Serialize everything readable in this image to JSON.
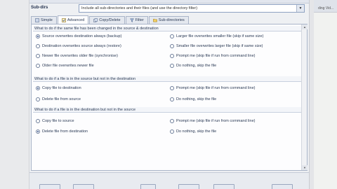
{
  "subdirs": {
    "label": "Sub-dirs",
    "value": "Include all sub-directories and their files (and use the directory filter)"
  },
  "right_hint": "ding Vid...",
  "tabs": [
    {
      "label": "Simple",
      "active": false
    },
    {
      "label": "Advanced",
      "active": true
    },
    {
      "label": "Copy/Delete",
      "active": false
    },
    {
      "label": "Filter",
      "active": false
    },
    {
      "label": "Sub-directories",
      "active": false
    }
  ],
  "groups": [
    {
      "header": "What to do if the same file has been changed in the source & destination",
      "options": [
        {
          "label": "Source overwrites destination always (backup)",
          "selected": true
        },
        {
          "label": "Larger file overwrites smaller file (skip if same size)",
          "selected": false
        },
        {
          "label": "Destination overwrites source always (restore)",
          "selected": false
        },
        {
          "label": "Smaller file overwrites larger file (skip if same size)",
          "selected": false
        },
        {
          "label": "Newer file overwrites older file (synchronise)",
          "selected": false
        },
        {
          "label": "Prompt me  (skip file if run from command line)",
          "selected": false
        },
        {
          "label": "Older file overwrites newer file",
          "selected": false
        },
        {
          "label": "Do nothing, skip the file",
          "selected": false
        }
      ]
    },
    {
      "header": "What to do if a file is in the source but not in the destination",
      "options": [
        {
          "label": "Copy file to destination",
          "selected": true
        },
        {
          "label": "Prompt me  (skip file if run from command line)",
          "selected": false
        },
        {
          "label": "Delete file from source",
          "selected": false
        },
        {
          "label": "Do nothing, skip the file",
          "selected": false
        }
      ]
    },
    {
      "header": "What to do if a file is in the destination but not in the source",
      "options": [
        {
          "label": "Copy file to source",
          "selected": false
        },
        {
          "label": "Prompt me  (skip file if run from command line)",
          "selected": false
        },
        {
          "label": "Delete file from destination",
          "selected": true
        },
        {
          "label": "Do nothing, skip the file",
          "selected": false
        }
      ]
    }
  ],
  "colors": {
    "accent": "#2d4a86",
    "panel": "#fdfdfe",
    "border": "#a9b4c8"
  }
}
